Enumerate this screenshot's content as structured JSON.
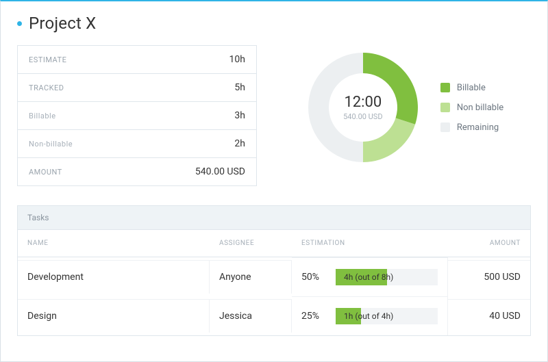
{
  "title": "Project X",
  "stats": {
    "estimate": {
      "label": "ESTIMATE",
      "value": "10h"
    },
    "tracked": {
      "label": "TRACKED",
      "value": "5h"
    },
    "billable": {
      "label": "Billable",
      "value": "3h"
    },
    "nonbillable": {
      "label": "Non-billable",
      "value": "2h"
    },
    "amount": {
      "label": "AMOUNT",
      "value": "540.00 USD"
    }
  },
  "donut": {
    "time": "12:00",
    "amount": "540.00 USD",
    "billable_pct": 30,
    "nonbillable_pct": 20,
    "remaining_pct": 50,
    "legend": {
      "billable": "Billable",
      "nonbillable": "Non billable",
      "remaining": "Remaining"
    }
  },
  "colors": {
    "billable": "#80bf3f",
    "nonbillable": "#bde093",
    "remaining": "#eceff1",
    "accent": "#2fb4e6"
  },
  "tasks": {
    "panel_title": "Tasks",
    "headers": {
      "name": "NAME",
      "assignee": "ASSIGNEE",
      "estimation": "ESTIMATION",
      "amount": "AMOUNT"
    },
    "rows": [
      {
        "name": "Development",
        "assignee": "Anyone",
        "pct": "50%",
        "pct_num": 50,
        "progress_label": "4h (out of 8h)",
        "amount": "500 USD"
      },
      {
        "name": "Design",
        "assignee": "Jessica",
        "pct": "25%",
        "pct_num": 25,
        "progress_label": "1h (out of 4h)",
        "amount": "40 USD"
      }
    ]
  },
  "chart_data": {
    "type": "pie",
    "title": "",
    "series": [
      {
        "name": "Billable",
        "value": 3,
        "unit": "h",
        "color": "#80bf3f"
      },
      {
        "name": "Non billable",
        "value": 2,
        "unit": "h",
        "color": "#bde093"
      },
      {
        "name": "Remaining",
        "value": 5,
        "unit": "h",
        "color": "#eceff1"
      }
    ],
    "center_labels": {
      "primary": "12:00",
      "secondary": "540.00 USD"
    },
    "legend_position": "right"
  }
}
